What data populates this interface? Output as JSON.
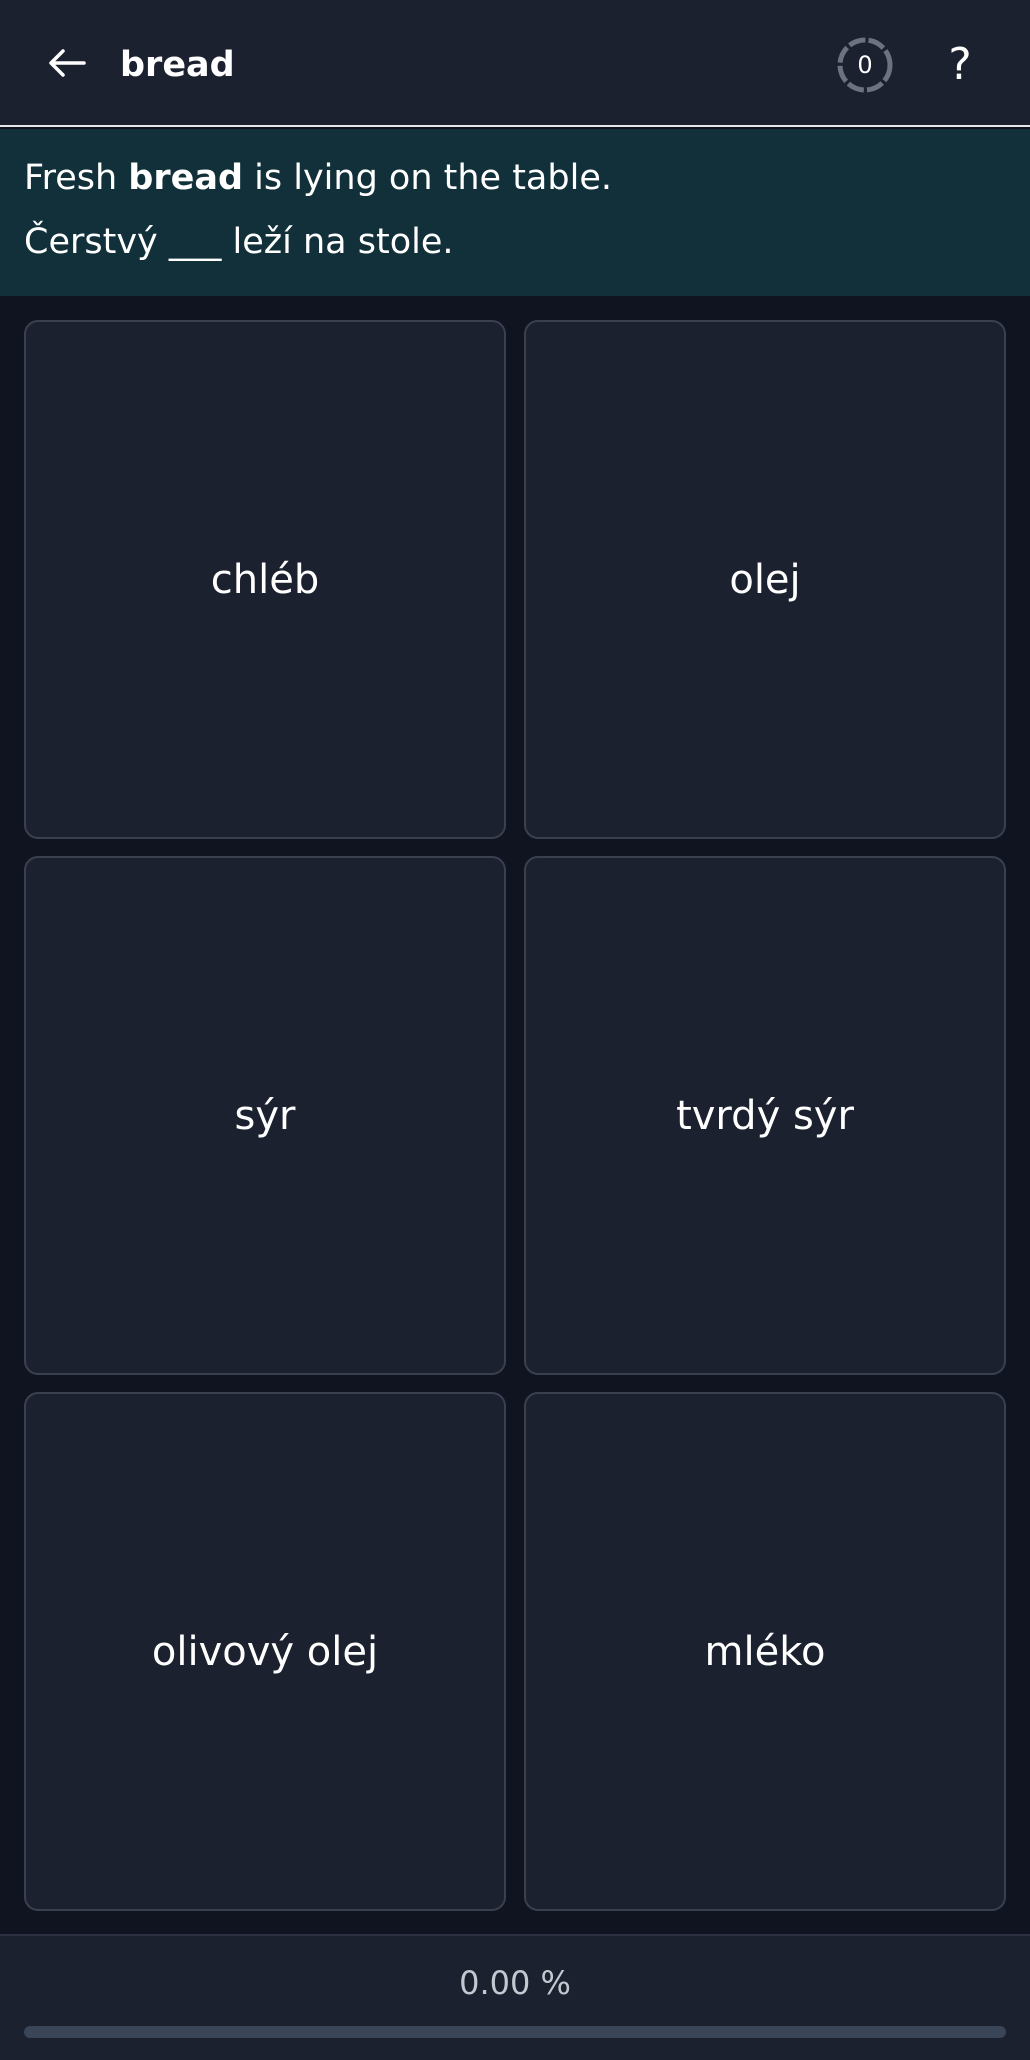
{
  "header": {
    "back_icon": "arrow-left-icon",
    "title": "bread",
    "counter_value": "0",
    "help_label": "?"
  },
  "sentence": {
    "english_before": "Fresh ",
    "english_highlight": "bread",
    "english_after": " is lying on the table.",
    "czech": "Čerstvý ___ leží na stole."
  },
  "options": [
    "chléb",
    "olej",
    "sýr",
    "tvrdý sýr",
    "olivový olej",
    "mléko"
  ],
  "progress": {
    "label": "0.00 %",
    "fraction": 0
  },
  "colors": {
    "background": "#0f1420",
    "card": "#1c2130",
    "banner": "#11303a",
    "track": "#3b4558"
  }
}
